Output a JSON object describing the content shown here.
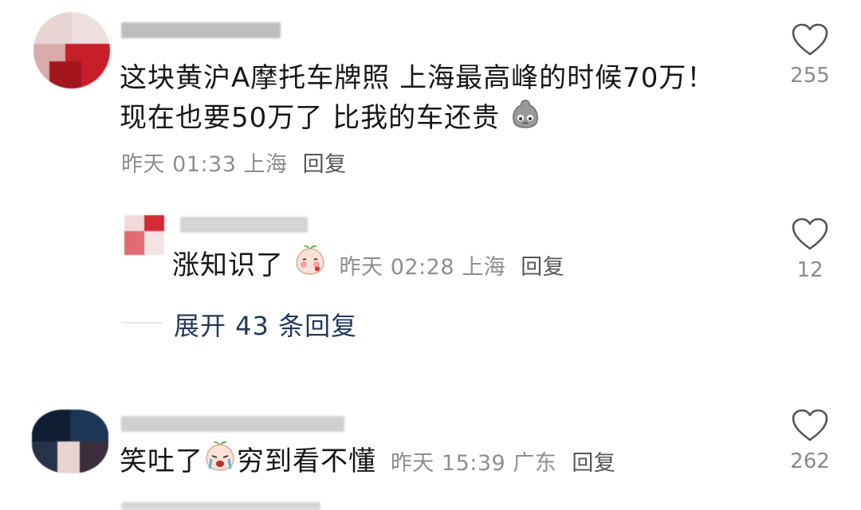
{
  "comments": [
    {
      "text_line1": "这块黄沪A摩托车牌照 上海最高峰的时候70万！",
      "text_line2": "现在也要50万了 比我的车还贵",
      "emoji_icon": "gray-bun-face-icon",
      "time": "昨天 01:33",
      "location": "上海",
      "reply_label": "回复",
      "likes": "255"
    },
    {
      "text": "涨知识了",
      "emoji_icon": "blushing-peach-face-icon",
      "time": "昨天 02:28",
      "location": "上海",
      "reply_label": "回复",
      "likes": "12"
    },
    {
      "text_before_emoji": "笑吐了",
      "text_after_emoji": "穷到看不懂",
      "emoji_icon": "crying-peach-face-icon",
      "time": "昨天 15:39",
      "location": "广东",
      "reply_label": "回复",
      "likes": "262"
    }
  ],
  "expand": {
    "label": "展开 43 条回复"
  },
  "colors": {
    "text": "#161616",
    "meta": "#8e8e8e",
    "expand_link": "#23395b",
    "heart_outline": "#555555"
  }
}
